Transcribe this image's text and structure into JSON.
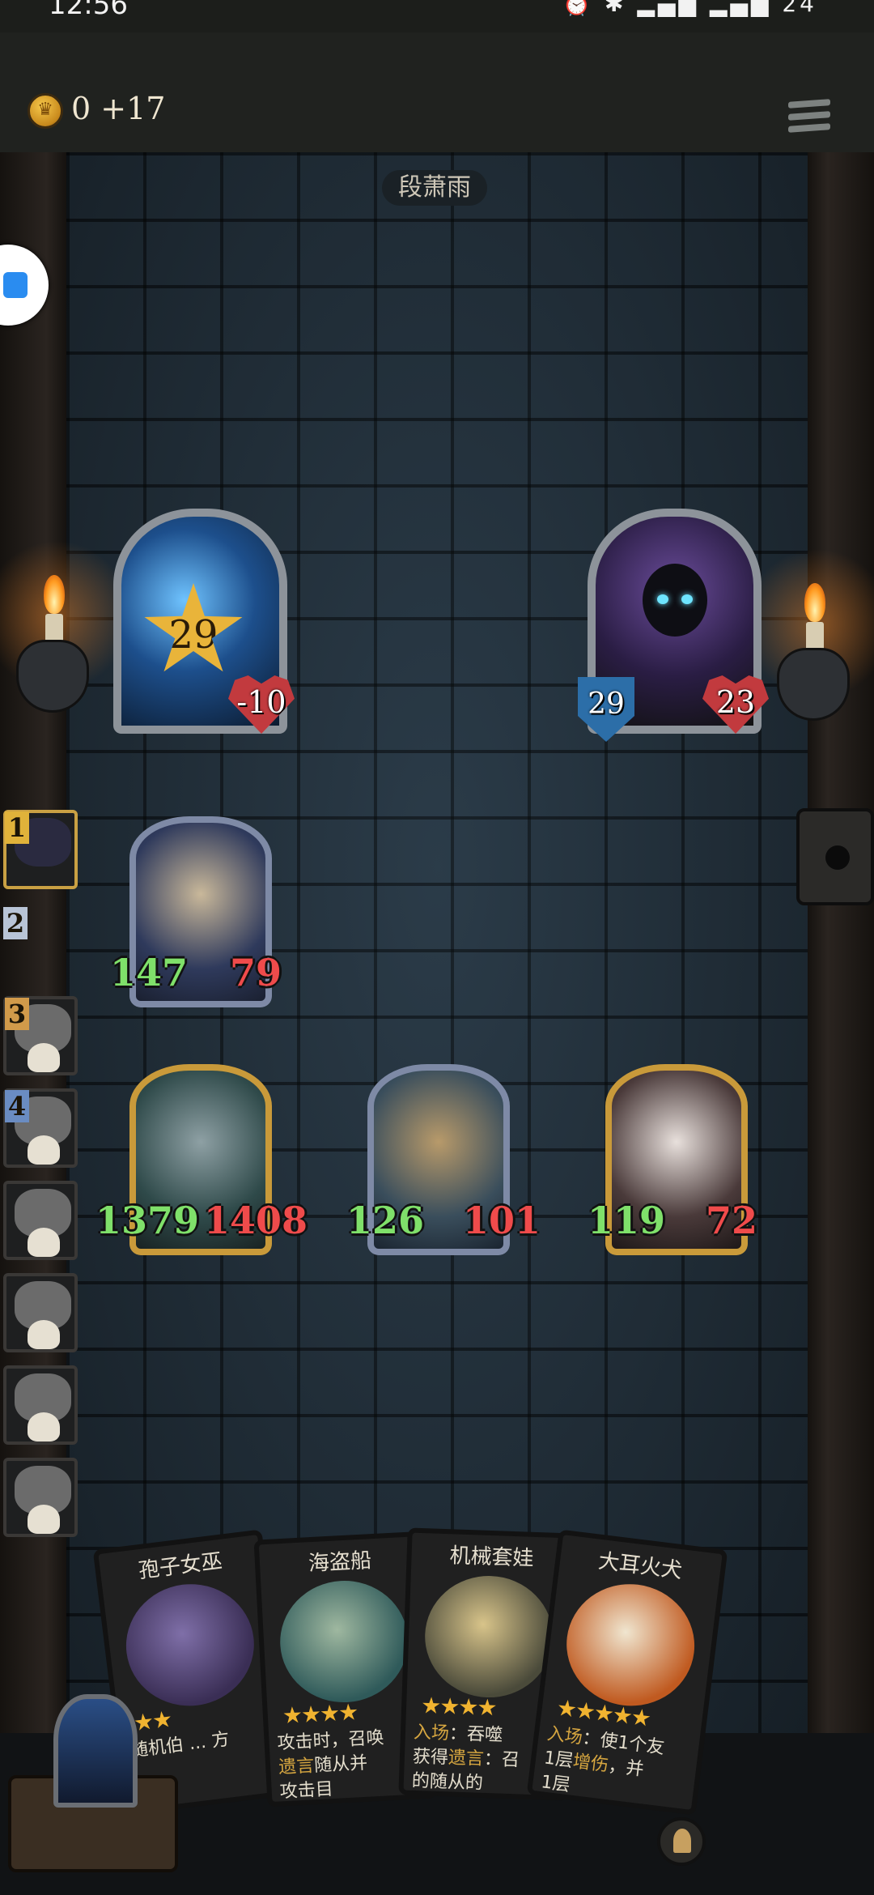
{
  "status": {
    "time": "12:56",
    "icons": "⏰ ✱ ▂▄▆ ▂▄▆ 24"
  },
  "top_bar": {
    "gold": "0 +17"
  },
  "opponent": {
    "name": "段萧雨"
  },
  "player_hero": {
    "tier": "29",
    "health": "-10"
  },
  "enemy_hero": {
    "armor": "29",
    "health": "23"
  },
  "ranking": [
    {
      "rank": "1",
      "state": "alive"
    },
    {
      "rank": "2",
      "state": "you"
    },
    {
      "rank": "3",
      "state": "dead"
    },
    {
      "rank": "4",
      "state": "dead"
    },
    {
      "rank": "",
      "state": "dead"
    },
    {
      "rank": "",
      "state": "dead"
    },
    {
      "rank": "",
      "state": "dead"
    },
    {
      "rank": "",
      "state": "dead"
    }
  ],
  "enemy_minions": [
    {
      "name": "witch",
      "attack": "147",
      "health": "79"
    }
  ],
  "player_minions": [
    {
      "name": "knight",
      "attack": "1379",
      "health": "1408"
    },
    {
      "name": "pirate-ship",
      "attack": "126",
      "health": "101"
    },
    {
      "name": "rabbit-mask",
      "attack": "119",
      "health": "72"
    }
  ],
  "hand": [
    {
      "title": "孢子女巫",
      "stars": "★★",
      "text": "随机伯 ... 方"
    },
    {
      "title": "海盗船",
      "stars": "★★★★",
      "text_a": "攻击时，召唤",
      "kw": "遗言",
      "text_b": "随从并",
      "text_c": "攻击目"
    },
    {
      "title": "机械套娃",
      "stars": "★★★★",
      "kw_a": "入场",
      "text_a": "：吞噬",
      "text_b": "获得",
      "kw_b": "遗言",
      "text_c": "：召",
      "text_d": "的随从的"
    },
    {
      "title": "大耳火犬",
      "stars": "★★★★★",
      "kw_a": "入场",
      "text_a": "：使1个友",
      "text_b": "1层",
      "kw_b": "增伤",
      "text_c": "，并",
      "text_d": "1层"
    }
  ]
}
